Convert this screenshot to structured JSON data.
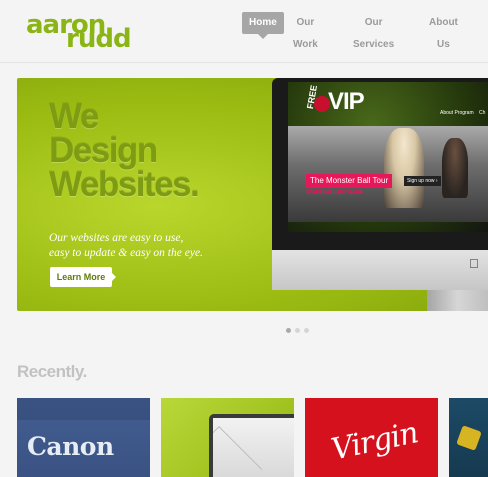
{
  "brand": {
    "line1": "aaron",
    "line2": "rudd",
    "color": "#8ab514"
  },
  "nav": {
    "items": [
      {
        "label": "Home",
        "active": true
      },
      {
        "label": "Our Work",
        "active": false
      },
      {
        "label": "Our Services",
        "active": false
      },
      {
        "label": "About Us",
        "active": false
      }
    ]
  },
  "hero": {
    "headline": [
      "We",
      "Design",
      "Websites."
    ],
    "tagline": [
      "Our websites are easy to use,",
      "easy to update & easy on the eye."
    ],
    "cta_label": "Learn More",
    "accent_color": "#9cbc13",
    "screen": {
      "free": "FREE",
      "vip": "VIP",
      "nav": [
        "About Program",
        "Ch"
      ],
      "banner": "The Monster Ball Tour",
      "subtitle": "STARRING LADY GAGA",
      "signup": "Sign up now ›"
    }
  },
  "slider": {
    "slide_count": 3,
    "active_index": 0
  },
  "recent": {
    "title": "Recently.",
    "items": [
      {
        "label": "Canon"
      },
      {
        "label": "mail",
        "icon": "envelope-icon"
      },
      {
        "label": "Virgin"
      },
      {
        "label": ""
      }
    ]
  }
}
